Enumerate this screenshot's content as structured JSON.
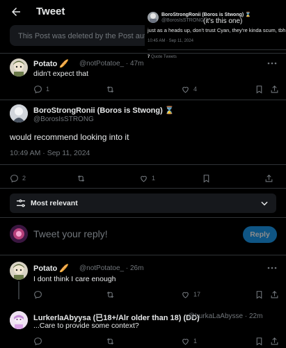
{
  "header": {
    "title": "Tweet"
  },
  "deleted_notice": "This Post was deleted by the Post author",
  "overlay": {
    "name": "BoroStrongRonii (Boros is Stwong) ⌛",
    "handle": "@BorosIsSTRONG",
    "annotation": "(it's this one)",
    "text": "just as a heads up, don't trust Cyan, they're kinda scum, tbh",
    "timestamp": "10:45 AM · Sep 11, 2024",
    "quotes_count": "7",
    "quotes_label": "Quote Tweets"
  },
  "reply1": {
    "name": "Potato 🥖",
    "handle": "@notPotatoe_ · 47m",
    "text": "didn't expect that",
    "replies": "1",
    "retweets": "",
    "likes": "4"
  },
  "main_tweet": {
    "name": "BoroStrongRonii (Boros is Stwong) ⌛",
    "handle": "@BorosIsSTRONG",
    "text": "would recommend looking into it",
    "timestamp": "10:49 AM · Sep 11, 2024",
    "replies": "2",
    "retweets": "",
    "likes": "1"
  },
  "sort": {
    "label": "Most relevant"
  },
  "compose": {
    "placeholder": "Tweet your reply!",
    "button": "Reply"
  },
  "reply2": {
    "name": "Potato 🥖",
    "handle": "@notPotatoe_ · 26m",
    "text": "I dont think I care enough",
    "likes": "17"
  },
  "reply3": {
    "name": "LurkerlaAbyysa (已18+/Alr older than 18) (DD)",
    "handle": "@LurkaLaAbysse · 22m",
    "text": "...Care to provide some context?",
    "likes": "1"
  },
  "colors": {
    "accent": "#1d9bf0",
    "background": "#000000",
    "muted": "#71767b"
  }
}
